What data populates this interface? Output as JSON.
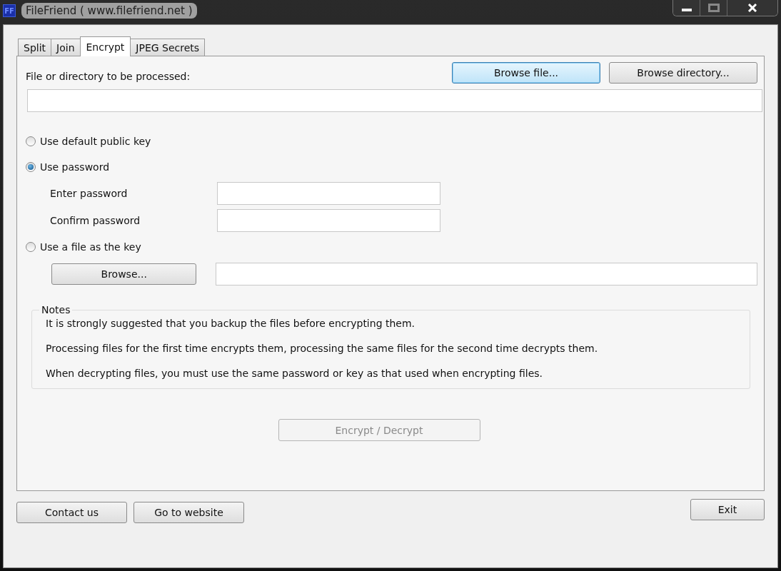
{
  "window": {
    "title": "FileFriend ( www.filefriend.net )",
    "app_icon_text": "FF"
  },
  "tabs": [
    {
      "label": "Split",
      "selected": false
    },
    {
      "label": "Join",
      "selected": false
    },
    {
      "label": "Encrypt",
      "selected": true
    },
    {
      "label": "JPEG Secrets",
      "selected": false
    }
  ],
  "target": {
    "label": "File or directory to be processed:",
    "buttons": [
      {
        "label": "Browse file...",
        "default": true
      },
      {
        "label": "Browse directory...",
        "default": false
      }
    ]
  },
  "key_options": [
    {
      "kind": "plain",
      "label": "Use default public key",
      "selected": false
    },
    {
      "kind": "password",
      "label": "Use password",
      "selected": true,
      "fields": [
        {
          "label": "Enter password"
        },
        {
          "label": "Confirm password"
        }
      ]
    },
    {
      "kind": "file",
      "label": "Use a file as the key",
      "selected": false,
      "browse_button": "Browse..."
    }
  ],
  "notes": {
    "title": "Notes",
    "lines": [
      "It is strongly suggested that you backup the files before encrypting them.",
      "Processing files for the first time encrypts them, processing the same files for the second time decrypts them.",
      "When decrypting files, you must use the same password or key as that used when encrypting files."
    ]
  },
  "action": {
    "label": "Encrypt / Decrypt",
    "disabled": true
  },
  "footer": {
    "left_buttons": [
      "Contact us",
      "Go to website"
    ],
    "right_button": "Exit"
  }
}
